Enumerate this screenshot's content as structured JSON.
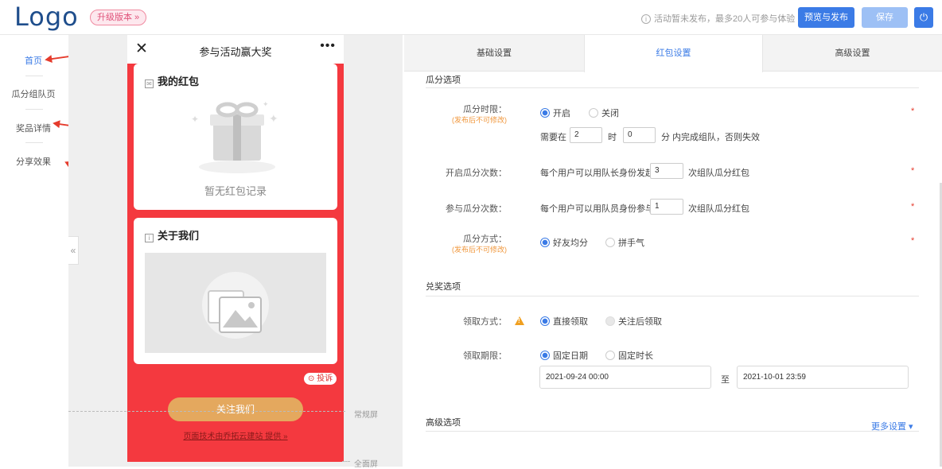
{
  "header": {
    "logo": "Logo",
    "upgrade": "升级版本 »",
    "notice": "活动暂未发布，最多20人可参与体验",
    "preview_publish": "预览与发布",
    "save": "保存"
  },
  "nav": {
    "items": [
      {
        "label": "首页",
        "active": true
      },
      {
        "label": "瓜分组队页",
        "active": false
      },
      {
        "label": "奖品详情",
        "active": false
      },
      {
        "label": "分享效果",
        "active": false
      }
    ],
    "collapse": "«"
  },
  "phone": {
    "title": "参与活动赢大奖",
    "close_icon": "close-icon",
    "more_icon": "more-icon",
    "card1_title": "我的红包",
    "card1_empty": "暂无红包记录",
    "card2_title": "关于我们",
    "complain": "投诉",
    "follow_btn": "关注我们",
    "support": "页面技术由乔拓云建站 提供 »",
    "normal_screen": "常规屏",
    "full_screen": "全面屏"
  },
  "tabs": [
    {
      "label": "基础设置",
      "active": false
    },
    {
      "label": "红包设置",
      "active": true
    },
    {
      "label": "高级设置",
      "active": false
    }
  ],
  "form": {
    "section1": "瓜分选项",
    "time_limit": {
      "label": "瓜分时限：",
      "note": "(发布后不可修改)",
      "opt_on": "开启",
      "opt_off": "关闭",
      "prefix": "需要在",
      "hours": "2",
      "hour_unit": "时",
      "minutes": "0",
      "suffix": "分 内完成组队，否则失效"
    },
    "start_count": {
      "label": "开启瓜分次数：",
      "prefix": "每个用户可以用队长身份发起",
      "value": "3",
      "suffix": "次组队瓜分红包"
    },
    "join_count": {
      "label": "参与瓜分次数：",
      "prefix": "每个用户可以用队员身份参与",
      "value": "1",
      "suffix": "次组队瓜分红包"
    },
    "split_method": {
      "label": "瓜分方式：",
      "note": "(发布后不可修改)",
      "opt_equal": "好友均分",
      "opt_luck": "拼手气"
    },
    "section2": "兑奖选项",
    "claim_method": {
      "label": "领取方式：",
      "opt_direct": "直接领取",
      "opt_follow": "关注后领取"
    },
    "claim_period": {
      "label": "领取期限：",
      "opt_fixed_date": "固定日期",
      "opt_fixed_duration": "固定时长",
      "start": "2021-09-24 00:00",
      "to": "至",
      "end": "2021-10-01 23:59"
    },
    "section3": "高级选项",
    "more_settings": "更多设置 ▾",
    "required_mark": "*"
  }
}
